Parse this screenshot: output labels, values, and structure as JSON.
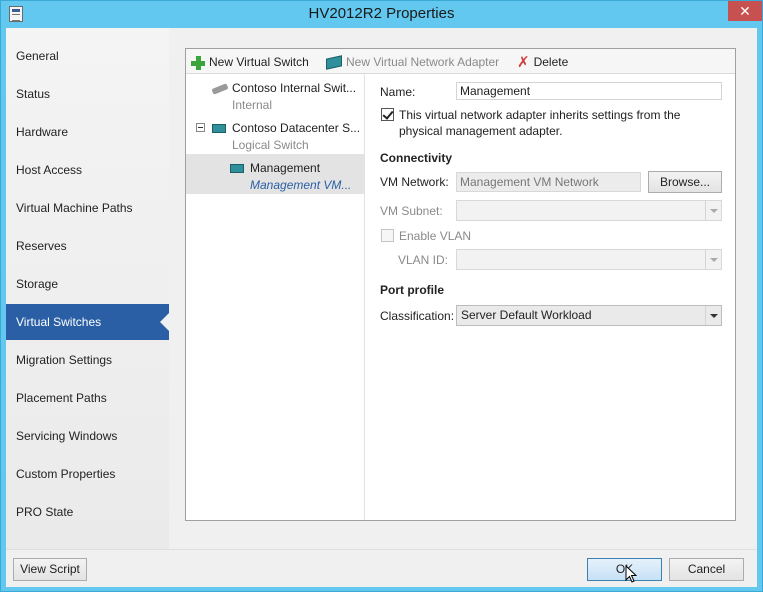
{
  "window": {
    "title": "HV2012R2 Properties",
    "close_label": "✕"
  },
  "nav": {
    "items": [
      {
        "label": "General"
      },
      {
        "label": "Status"
      },
      {
        "label": "Hardware"
      },
      {
        "label": "Host Access"
      },
      {
        "label": "Virtual Machine Paths"
      },
      {
        "label": "Reserves"
      },
      {
        "label": "Storage"
      },
      {
        "label": "Virtual Switches",
        "selected": true
      },
      {
        "label": "Migration Settings"
      },
      {
        "label": "Placement Paths"
      },
      {
        "label": "Servicing Windows"
      },
      {
        "label": "Custom Properties"
      },
      {
        "label": "PRO State"
      }
    ]
  },
  "toolbar": {
    "new_switch": "New Virtual Switch",
    "new_adapter": "New Virtual Network Adapter",
    "delete": "Delete"
  },
  "tree": {
    "nodes": [
      {
        "title": "Contoso Internal Swit...",
        "subtitle": "Internal"
      },
      {
        "title": "Contoso Datacenter S...",
        "subtitle": "Logical Switch"
      },
      {
        "title": "Management",
        "subtitle": "Management VM..."
      }
    ]
  },
  "details": {
    "name_label": "Name:",
    "name_value": "Management",
    "inherit_text_line1": "This virtual network adapter inherits settings from the",
    "inherit_text_line2": "physical management adapter.",
    "connectivity_heading": "Connectivity",
    "vm_network_label": "VM Network:",
    "vm_network_value": "Management VM Network",
    "browse_label": "Browse...",
    "vm_subnet_label": "VM Subnet:",
    "enable_vlan_label": "Enable VLAN",
    "vlan_id_label": "VLAN ID:",
    "port_profile_heading": "Port profile",
    "classification_label": "Classification:",
    "classification_value": "Server Default Workload"
  },
  "footer": {
    "view_script": "View Script",
    "ok": "OK",
    "cancel": "Cancel"
  },
  "colors": {
    "accent": "#2a5fa5",
    "frame": "#62c8ef",
    "close": "#c75050"
  }
}
